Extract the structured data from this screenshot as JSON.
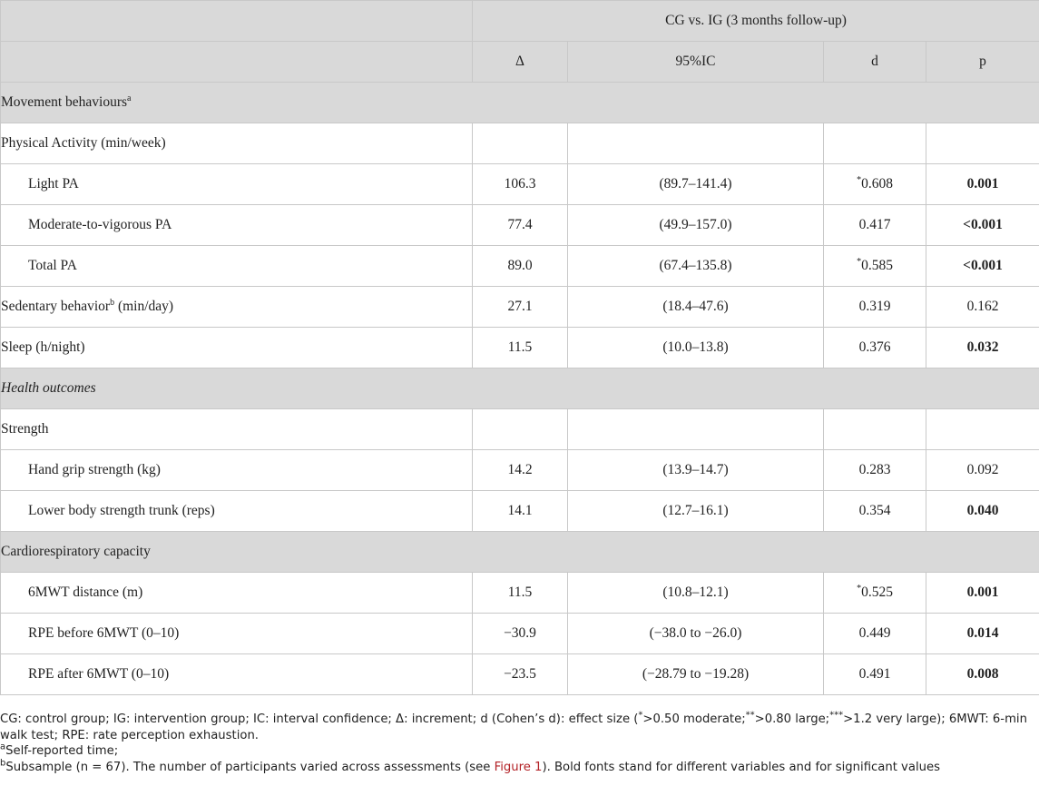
{
  "header": {
    "group_title": "CG vs. IG (3 months follow-up)",
    "columns": [
      "Δ",
      "95%IC",
      "d",
      "p"
    ]
  },
  "sections": [
    {
      "title": "Movement behaviours",
      "title_sup": "a",
      "italic": false,
      "rows": [
        {
          "label": "Physical Activity (min/week)",
          "indent": false,
          "delta": "",
          "ci": "",
          "d_mark": "",
          "d": "",
          "p": "",
          "p_bold": false
        },
        {
          "label": "Light PA",
          "indent": true,
          "delta": "106.3",
          "ci": "(89.7–141.4)",
          "d_mark": "*",
          "d": "0.608",
          "p": "0.001",
          "p_bold": true
        },
        {
          "label": "Moderate-to-vigorous PA",
          "indent": true,
          "delta": "77.4",
          "ci": "(49.9–157.0)",
          "d_mark": "",
          "d": "0.417",
          "p": "<0.001",
          "p_bold": true
        },
        {
          "label": "Total PA",
          "indent": true,
          "delta": "89.0",
          "ci": "(67.4–135.8)",
          "d_mark": "*",
          "d": "0.585",
          "p": "<0.001",
          "p_bold": true
        },
        {
          "label": "Sedentary behavior",
          "label_sup": "b",
          "label_suffix": " (min/day)",
          "indent": false,
          "delta": "27.1",
          "ci": "(18.4–47.6)",
          "d_mark": "",
          "d": "0.319",
          "p": "0.162",
          "p_bold": false
        },
        {
          "label": "Sleep (h/night)",
          "indent": false,
          "delta": "11.5",
          "ci": "(10.0–13.8)",
          "d_mark": "",
          "d": "0.376",
          "p": "0.032",
          "p_bold": true
        }
      ]
    },
    {
      "title": "Health outcomes",
      "title_sup": "",
      "italic": true,
      "rows": [
        {
          "label": "Strength",
          "indent": false,
          "delta": "",
          "ci": "",
          "d_mark": "",
          "d": "",
          "p": "",
          "p_bold": false
        },
        {
          "label": "Hand grip strength (kg)",
          "indent": true,
          "delta": "14.2",
          "ci": "(13.9–14.7)",
          "d_mark": "",
          "d": "0.283",
          "p": "0.092",
          "p_bold": false
        },
        {
          "label": "Lower body strength trunk (reps)",
          "indent": true,
          "delta": "14.1",
          "ci": "(12.7–16.1)",
          "d_mark": "",
          "d": "0.354",
          "p": "0.040",
          "p_bold": true
        }
      ]
    },
    {
      "title": "Cardiorespiratory capacity",
      "title_sup": "",
      "italic": false,
      "rows": [
        {
          "label": "6MWT distance (m)",
          "indent": true,
          "delta": "11.5",
          "ci": "(10.8–12.1)",
          "d_mark": "*",
          "d": "0.525",
          "p": "0.001",
          "p_bold": true
        },
        {
          "label": "RPE before 6MWT (0–10)",
          "indent": true,
          "delta": "−30.9",
          "ci": "(−38.0 to −26.0)",
          "d_mark": "",
          "d": "0.449",
          "p": "0.014",
          "p_bold": true
        },
        {
          "label": "RPE after 6MWT (0–10)",
          "indent": true,
          "delta": "−23.5",
          "ci": "(−28.79 to −19.28)",
          "d_mark": "",
          "d": "0.491",
          "p": "0.008",
          "p_bold": true
        }
      ]
    }
  ],
  "footnotes": {
    "abbrev_1": "CG: control group; IG: intervention group; IC: interval confidence; Δ: increment; d (Cohen’s d): effect size (",
    "abbrev_s1": "*",
    "abbrev_2": ">0.50 moderate;",
    "abbrev_s2": "**",
    "abbrev_3": ">0.80 large;",
    "abbrev_s3": "***",
    "abbrev_4": ">1.2 very large); 6MWT: 6-min walk test; RPE: rate perception exhaustion.",
    "a_mark": "a",
    "a_text": "Self-reported time;",
    "b_mark": "b",
    "b_text_1": "Subsample (n = 67). The number of participants varied across assessments (see ",
    "b_link": "Figure 1",
    "b_text_2": "). Bold fonts stand for different variables and for significant values"
  }
}
